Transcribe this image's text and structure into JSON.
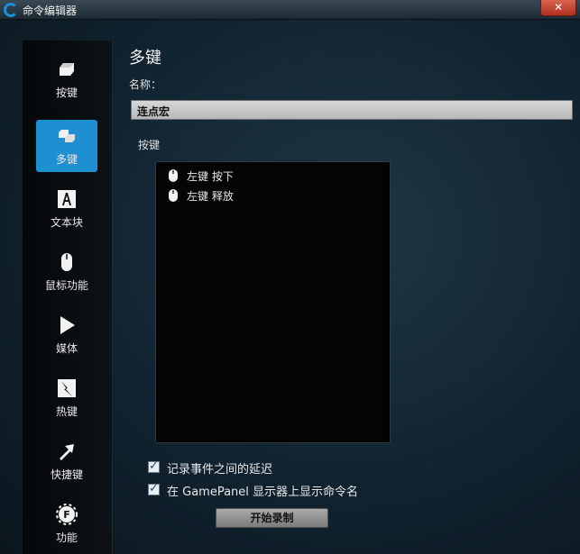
{
  "window": {
    "title": "命令编辑器",
    "close_label": "✕"
  },
  "sidebar": {
    "items": [
      {
        "label": "按键",
        "icon": "keycap-icon",
        "active": false
      },
      {
        "label": "多键",
        "icon": "multi-key-icon",
        "active": true
      },
      {
        "label": "文本块",
        "icon": "text-block-icon",
        "active": false
      },
      {
        "label": "鼠标功能",
        "icon": "mouse-icon",
        "active": false
      },
      {
        "label": "媒体",
        "icon": "play-icon",
        "active": false
      },
      {
        "label": "热键",
        "icon": "hotkey-icon",
        "active": false
      },
      {
        "label": "快捷键",
        "icon": "shortcut-arrow-icon",
        "active": false
      },
      {
        "label": "功能",
        "icon": "function-gear-icon",
        "active": false
      }
    ]
  },
  "main": {
    "heading": "多键",
    "name_label": "名称：",
    "name_value": "连点宏",
    "keys_label": "按键",
    "key_events": [
      {
        "text": "左键 按下",
        "icon": "mouse-icon"
      },
      {
        "text": "左键 释放",
        "icon": "mouse-icon"
      }
    ],
    "options": [
      {
        "label": "记录事件之间的延迟",
        "checked": true
      },
      {
        "label": "在 GamePanel 显示器上显示命令名",
        "checked": true
      }
    ],
    "record_button": "开始录制"
  }
}
